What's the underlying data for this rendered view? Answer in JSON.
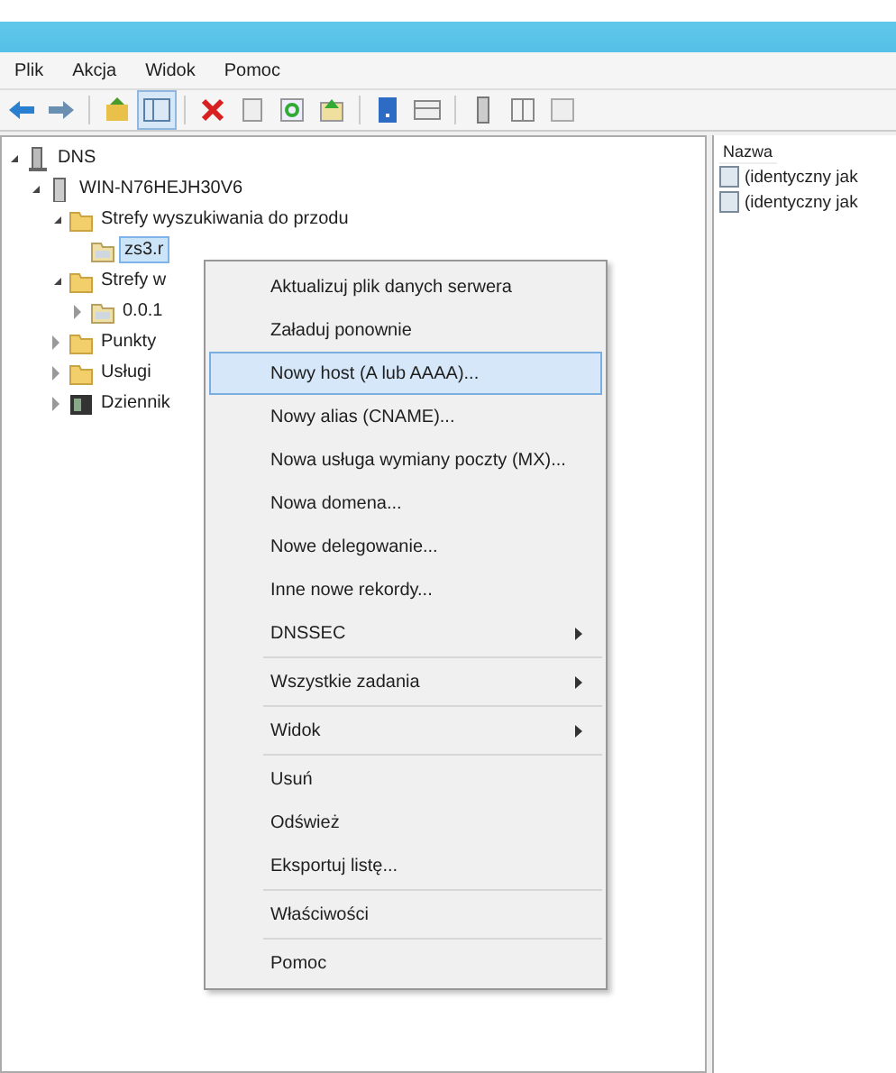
{
  "menu_bar": [
    "Plik",
    "Akcja",
    "Widok",
    "Pomoc"
  ],
  "tree": [
    {
      "label": "DNS",
      "kind": "dns",
      "expanded": true,
      "selected": false,
      "children": [
        {
          "label": "WIN-N76HEJH30V6",
          "kind": "server",
          "expanded": true,
          "selected": false,
          "children": [
            {
              "label": "Strefy wyszukiwania do przodu",
              "kind": "folder",
              "expanded": true,
              "selected": false,
              "children": [
                {
                  "label": "zs3.r",
                  "kind": "zone",
                  "selected": true
                }
              ]
            },
            {
              "label": "Strefy w",
              "kind": "folder",
              "expanded": true,
              "selected": false,
              "children": [
                {
                  "label": "0.0.1",
                  "kind": "zone",
                  "expanded": false,
                  "selected": false
                }
              ]
            },
            {
              "label": "Punkty",
              "kind": "folder",
              "expanded": false,
              "selected": false
            },
            {
              "label": "Usługi",
              "kind": "folder",
              "expanded": false,
              "selected": false
            },
            {
              "label": "Dziennik",
              "kind": "log",
              "expanded": false,
              "selected": false
            }
          ]
        }
      ]
    }
  ],
  "context_menu": [
    {
      "kind": "item",
      "label": "Aktualizuj plik danych serwera",
      "submenu": false,
      "selected": false
    },
    {
      "kind": "item",
      "label": "Załaduj ponownie",
      "submenu": false,
      "selected": false
    },
    {
      "kind": "item",
      "label": "Nowy host (A lub AAAA)...",
      "submenu": false,
      "selected": true
    },
    {
      "kind": "item",
      "label": "Nowy alias (CNAME)...",
      "submenu": false,
      "selected": false
    },
    {
      "kind": "item",
      "label": "Nowa usługa wymiany poczty (MX)...",
      "submenu": false,
      "selected": false
    },
    {
      "kind": "item",
      "label": "Nowa domena...",
      "submenu": false,
      "selected": false
    },
    {
      "kind": "item",
      "label": "Nowe delegowanie...",
      "submenu": false,
      "selected": false
    },
    {
      "kind": "item",
      "label": "Inne nowe rekordy...",
      "submenu": false,
      "selected": false
    },
    {
      "kind": "item",
      "label": "DNSSEC",
      "submenu": true,
      "selected": false
    },
    {
      "kind": "separator"
    },
    {
      "kind": "item",
      "label": "Wszystkie zadania",
      "submenu": true,
      "selected": false
    },
    {
      "kind": "separator"
    },
    {
      "kind": "item",
      "label": "Widok",
      "submenu": true,
      "selected": false
    },
    {
      "kind": "separator"
    },
    {
      "kind": "item",
      "label": "Usuń",
      "submenu": false,
      "selected": false
    },
    {
      "kind": "item",
      "label": "Odśwież",
      "submenu": false,
      "selected": false
    },
    {
      "kind": "item",
      "label": "Eksportuj listę...",
      "submenu": false,
      "selected": false
    },
    {
      "kind": "separator"
    },
    {
      "kind": "item",
      "label": "Właściwości",
      "submenu": false,
      "selected": false
    },
    {
      "kind": "separator"
    },
    {
      "kind": "item",
      "label": "Pomoc",
      "submenu": false,
      "selected": false
    }
  ],
  "details": {
    "column": "Nazwa",
    "rows": [
      "(identyczny jak",
      "(identyczny jak"
    ]
  }
}
